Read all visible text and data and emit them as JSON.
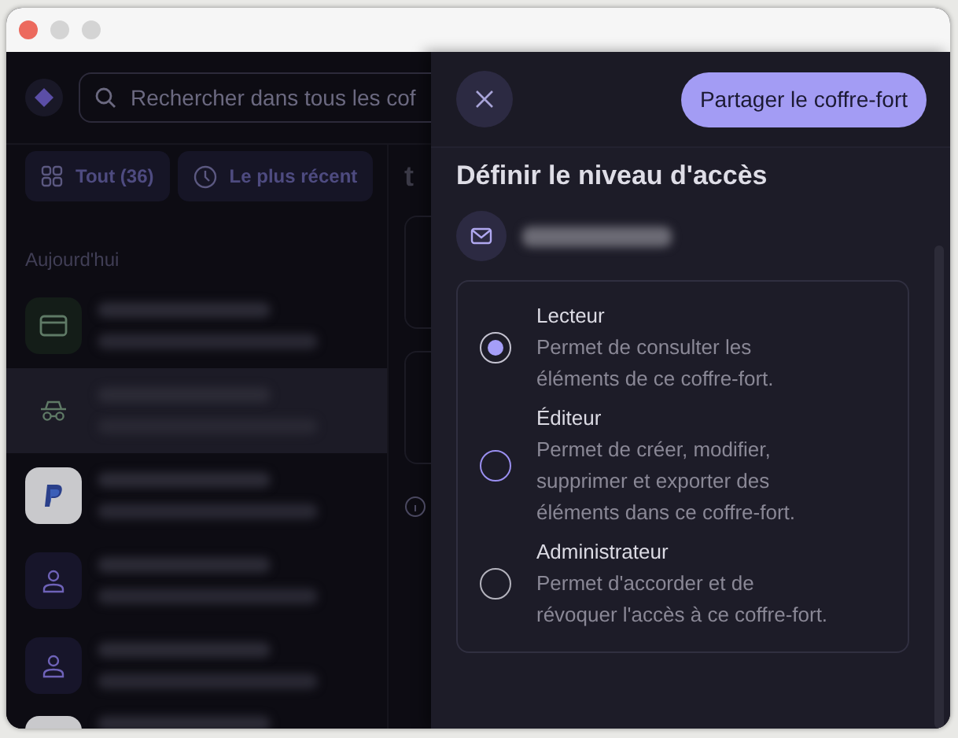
{
  "search": {
    "placeholder": "Rechercher dans tous les cof"
  },
  "filters": [
    {
      "kind": "grid",
      "label": "Tout (36)"
    },
    {
      "kind": "clock",
      "label": "Le plus récent"
    }
  ],
  "section_label": "Aujourd'hui",
  "items": [
    {
      "kind": "card",
      "selected": false
    },
    {
      "kind": "incognito",
      "selected": true
    },
    {
      "kind": "paypal",
      "selected": false
    },
    {
      "kind": "person",
      "selected": false
    },
    {
      "kind": "person",
      "selected": false
    },
    {
      "kind": "plain",
      "selected": false
    }
  ],
  "main_heading": "t",
  "panel": {
    "share_button": "Partager le coffre-fort",
    "title": "Définir le niveau d'accès",
    "options": [
      {
        "label": "Lecteur",
        "description": "Permet de consulter les éléments de ce coffre-fort.",
        "selected": true
      },
      {
        "label": "Éditeur",
        "description": "Permet de créer, modifier, supprimer et exporter des éléments dans ce coffre-fort.",
        "selected": false
      },
      {
        "label": "Administrateur",
        "description": "Permet d'accorder et de révoquer l'accès à ce coffre-fort.",
        "selected": false
      }
    ]
  }
}
